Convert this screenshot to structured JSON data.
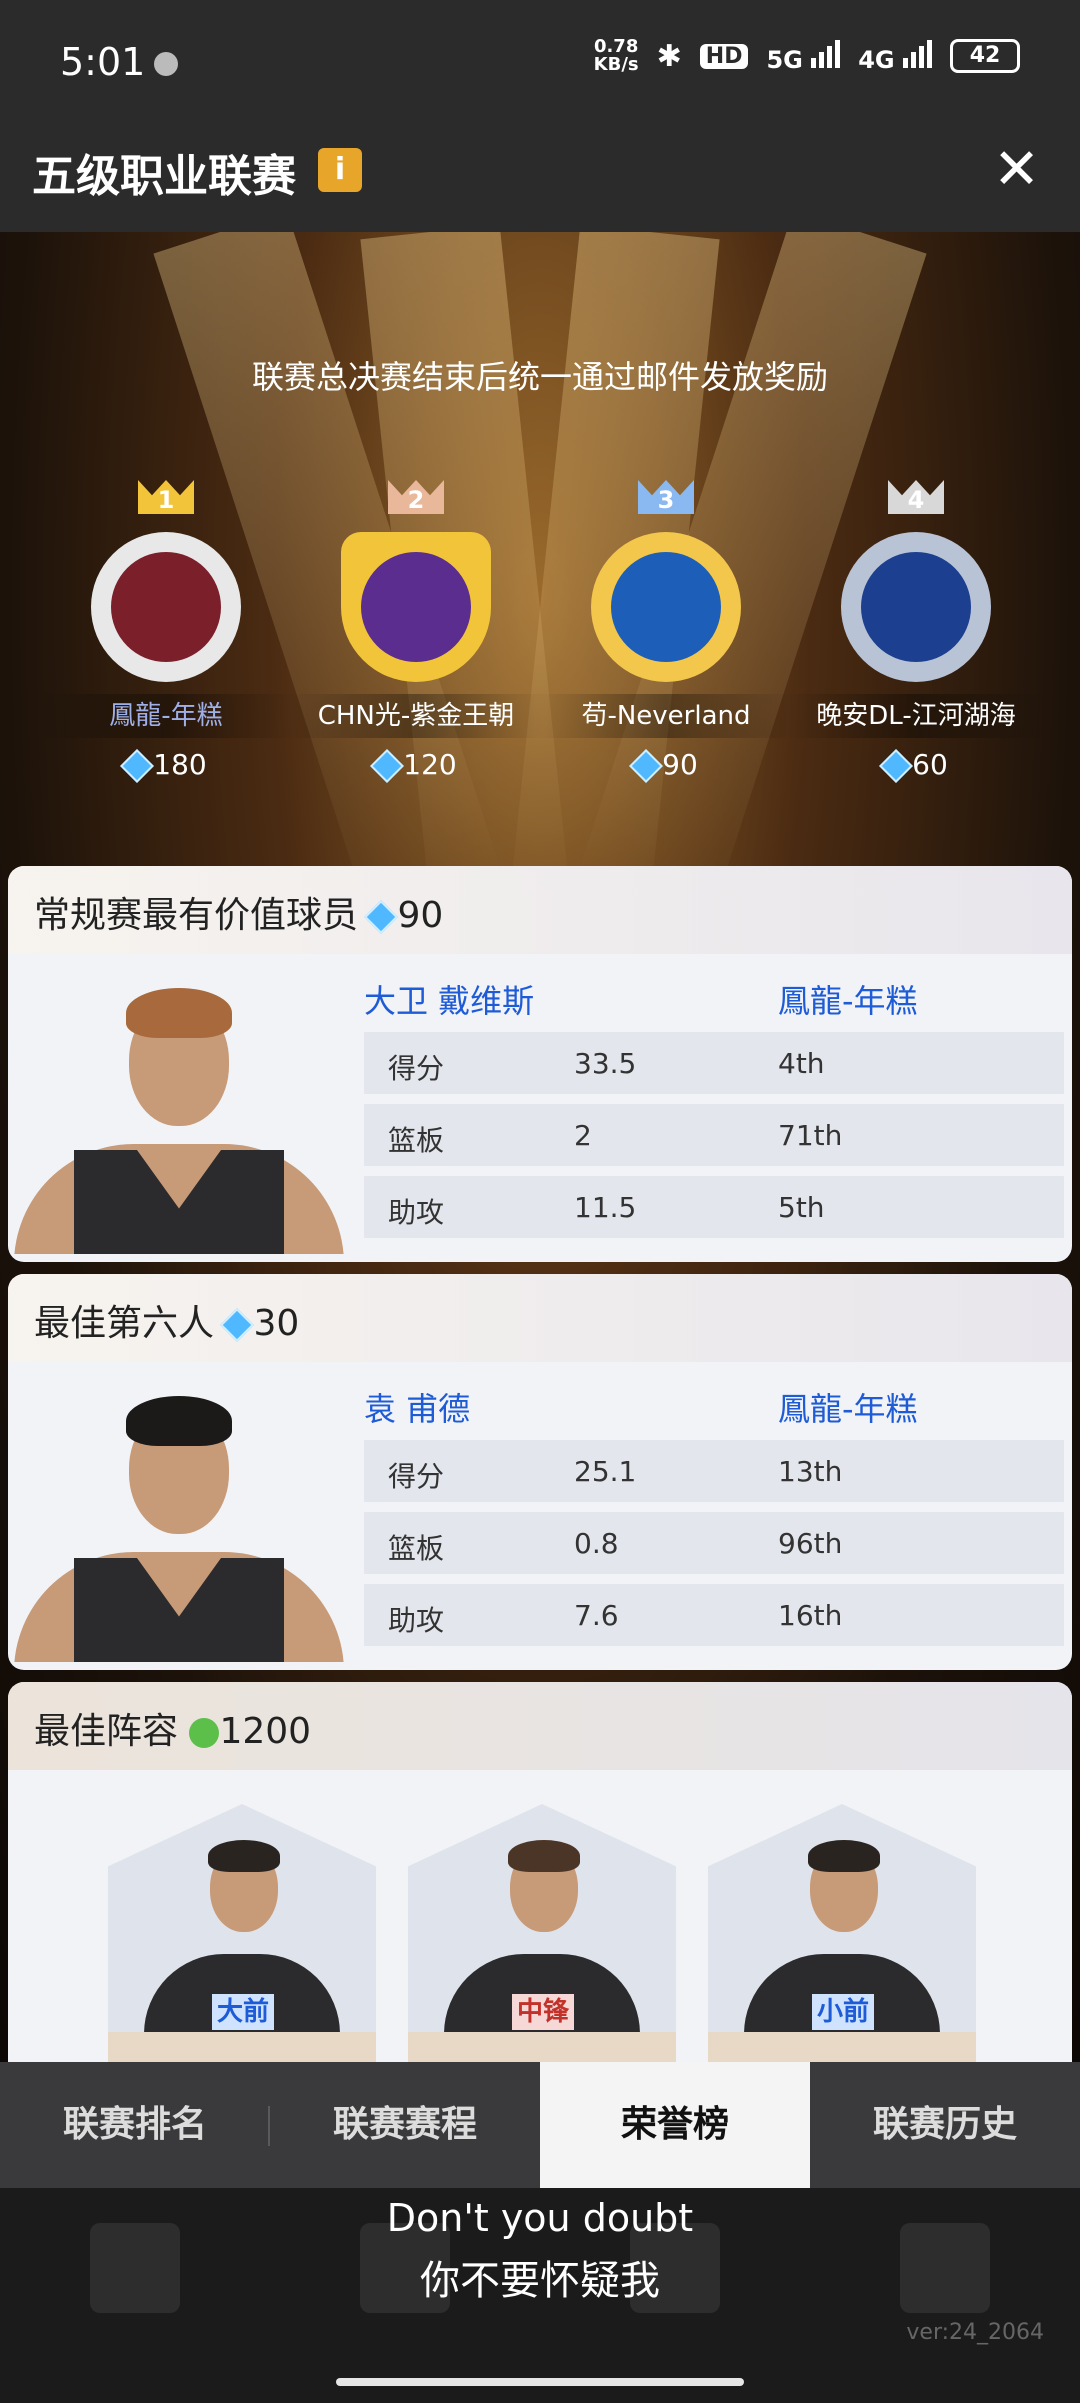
{
  "status_bar": {
    "time": "5:01",
    "net_speed_value": "0.78",
    "net_speed_unit": "KB/s",
    "hd_label": "HD",
    "network_1": "5G",
    "network_2": "4G",
    "battery": "42"
  },
  "header": {
    "title": "五级职业联赛",
    "info_icon": "i",
    "close_icon": "✕"
  },
  "notice": "联赛总决赛结束后统一通过邮件发放奖励",
  "podium": [
    {
      "rank": "1",
      "name": "鳳龍-年糕",
      "reward": "180",
      "crown_color": "#f2c43a",
      "logo_color": "#7b1f2b"
    },
    {
      "rank": "2",
      "name": "CHN光-紫金王朝",
      "reward": "120",
      "crown_color": "#e9b79a",
      "logo_color": "#5b2d8f"
    },
    {
      "rank": "3",
      "name": "苟-Neverland",
      "reward": "90",
      "crown_color": "#8ab8f0",
      "logo_color": "#1d5fb8"
    },
    {
      "rank": "4",
      "name": "晚安DL-江河湖海",
      "reward": "60",
      "crown_color": "#d8d8d8",
      "logo_color": "#1c3f8f"
    }
  ],
  "mvp": {
    "title": "常规赛最有价值球员",
    "reward": "90",
    "player": "大卫 戴维斯",
    "team": "鳳龍-年糕",
    "stats": [
      {
        "label": "得分",
        "value": "33.5",
        "rank": "4th"
      },
      {
        "label": "篮板",
        "value": "2",
        "rank": "71th"
      },
      {
        "label": "助攻",
        "value": "11.5",
        "rank": "5th"
      }
    ]
  },
  "sixth_man": {
    "title": "最佳第六人",
    "reward": "30",
    "player": "袁 甫德",
    "team": "鳳龍-年糕",
    "stats": [
      {
        "label": "得分",
        "value": "25.1",
        "rank": "13th"
      },
      {
        "label": "篮板",
        "value": "0.8",
        "rank": "96th"
      },
      {
        "label": "助攻",
        "value": "7.6",
        "rank": "16th"
      }
    ]
  },
  "lineup": {
    "title": "最佳阵容",
    "reward": "1200",
    "positions": [
      "大前",
      "中锋",
      "小前"
    ]
  },
  "tabs": [
    "联赛排名",
    "联赛赛程",
    "荣誉榜",
    "联赛历史"
  ],
  "subtitle": {
    "line1": "Don't you doubt",
    "line2": "你不要怀疑我"
  },
  "version": "ver:24_2064"
}
